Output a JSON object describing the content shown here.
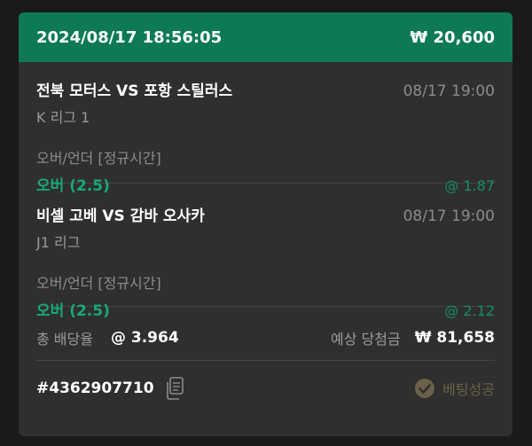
{
  "header": {
    "datetime": "2024/08/17 18:56:05",
    "stake": "₩ 20,600"
  },
  "matches": [
    {
      "teams": "전북 모터스 VS 포항 스틸러스",
      "time": "08/17 19:00",
      "league": "K 리그 1",
      "market": "오버/언더 [정규시간]",
      "pick": "오버 (2.5)",
      "odds": "@ 1.87"
    },
    {
      "teams": "비셀 고베 VS 감바 오사카",
      "time": "08/17 19:00",
      "league": "J1 리그",
      "market": "오버/언더 [정규시간]",
      "pick": "오버 (2.5)",
      "odds": "@ 2.12"
    }
  ],
  "summary": {
    "total_odds_label": "총 배당율",
    "total_odds_value": "@ 3.964",
    "expected_win_label": "예상 당첨금",
    "expected_win_value": "₩ 81,658"
  },
  "footer": {
    "ticket_id": "#4362907710",
    "status": "베팅성공"
  },
  "icons": {
    "copy": "copy-icon",
    "status": "check-circle-icon"
  },
  "colors": {
    "header_bg": "#0d7a55",
    "accent_green": "#17a878",
    "card_bg": "#2f2f2f",
    "status_gold": "#6b6148"
  }
}
